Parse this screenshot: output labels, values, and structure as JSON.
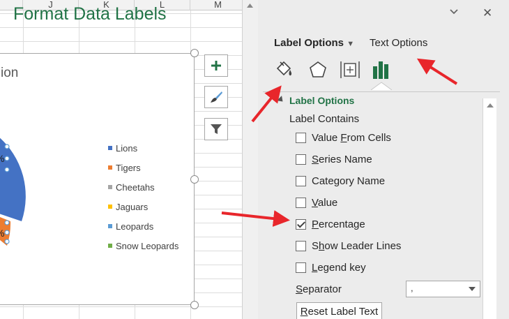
{
  "sheet": {
    "columns": [
      "J",
      "K",
      "L",
      "M"
    ]
  },
  "chart": {
    "title_partial": "ion",
    "data_labels": [
      "%",
      "%"
    ],
    "legend": [
      {
        "label": "Lions",
        "color": "#4472c4"
      },
      {
        "label": "Tigers",
        "color": "#ed7d31"
      },
      {
        "label": "Cheetahs",
        "color": "#a5a5a5"
      },
      {
        "label": "Jaguars",
        "color": "#ffc000"
      },
      {
        "label": "Leopards",
        "color": "#5b9bd5"
      },
      {
        "label": "Snow Leopards",
        "color": "#70ad47"
      }
    ],
    "buttons": [
      {
        "name": "chart-elements-button",
        "icon": "plus-icon"
      },
      {
        "name": "chart-styles-button",
        "icon": "paintbrush-icon"
      },
      {
        "name": "chart-filters-button",
        "icon": "filter-icon"
      }
    ]
  },
  "panel": {
    "title": "Format Data Labels",
    "tabs": {
      "label_options": "Label Options",
      "text_options": "Text Options"
    },
    "tab_icons": [
      "fill-line-icon",
      "effects-pentagon-icon",
      "size-properties-icon",
      "label-options-chart-icon"
    ],
    "section_title": "Label Options",
    "label_contains": "Label Contains",
    "options": [
      {
        "pre": "Value ",
        "u": "F",
        "post": "rom Cells",
        "checked": false
      },
      {
        "pre": "",
        "u": "S",
        "post": "eries Name",
        "checked": false
      },
      {
        "pre": "Cate",
        "u": "g",
        "post": "ory Name",
        "checked": false
      },
      {
        "pre": "",
        "u": "V",
        "post": "alue",
        "checked": false
      },
      {
        "pre": "",
        "u": "P",
        "post": "ercentage",
        "checked": true
      },
      {
        "pre": "S",
        "u": "h",
        "post": "ow Leader Lines",
        "checked": false
      },
      {
        "pre": "",
        "u": "L",
        "post": "egend key",
        "checked": false
      }
    ],
    "separator": {
      "pre": "",
      "u": "S",
      "post": "eparator",
      "value": ","
    },
    "reset": {
      "pre": "",
      "u": "R",
      "post": "eset Label Text"
    }
  },
  "colors": {
    "accent_green": "#217346",
    "annotation_red": "#e8262b"
  }
}
